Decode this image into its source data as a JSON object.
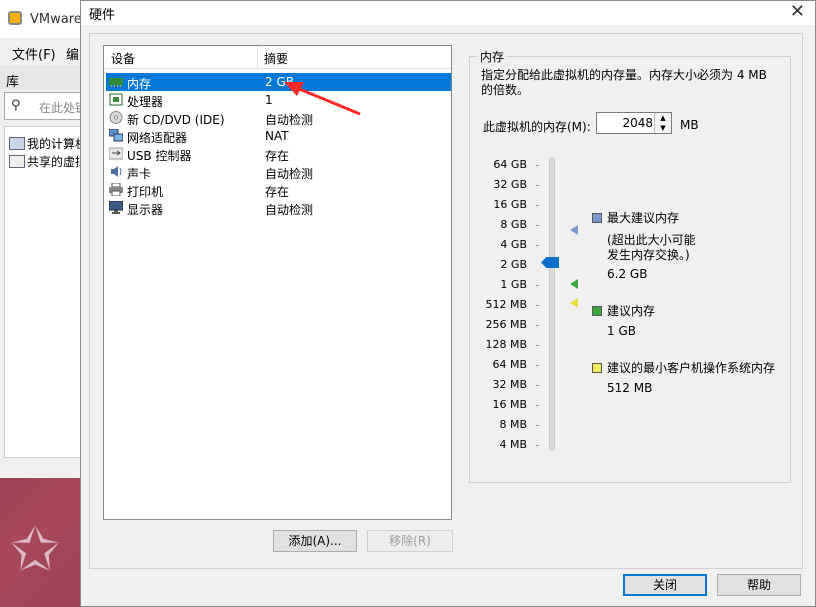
{
  "vmware": {
    "title": "VMware",
    "menu": [
      "文件(F)",
      "编"
    ],
    "library_label": "库",
    "search_placeholder": "在此处键入",
    "tree": [
      "我的计算机",
      "共享的虚拟机"
    ]
  },
  "dialog": {
    "title": "硬件",
    "list_headers": {
      "device": "设备",
      "summary": "摘要"
    },
    "devices": [
      {
        "name": "内存",
        "summary": "2 GB",
        "icon": "memory-icon",
        "selected": true
      },
      {
        "name": "处理器",
        "summary": "1",
        "icon": "processor-icon"
      },
      {
        "name": "新 CD/DVD (IDE)",
        "summary": "自动检测",
        "icon": "cd-icon"
      },
      {
        "name": "网络适配器",
        "summary": "NAT",
        "icon": "network-icon"
      },
      {
        "name": "USB 控制器",
        "summary": "存在",
        "icon": "usb-icon"
      },
      {
        "name": "声卡",
        "summary": "自动检测",
        "icon": "sound-icon"
      },
      {
        "name": "打印机",
        "summary": "存在",
        "icon": "printer-icon"
      },
      {
        "name": "显示器",
        "summary": "自动检测",
        "icon": "display-icon"
      }
    ],
    "add_button": "添加(A)...",
    "remove_button": "移除(R)",
    "close_button": "关闭",
    "help_button": "帮助"
  },
  "memory": {
    "group_title": "内存",
    "description": "指定分配给此虚拟机的内存量。内存大小必须为 4 MB 的倍数。",
    "field_label": "此虚拟机的内存(M):",
    "value": "2048",
    "unit": "MB",
    "scale": [
      "64 GB",
      "32 GB",
      "16 GB",
      "8 GB",
      "4 GB",
      "2 GB",
      "1 GB",
      "512 MB",
      "256 MB",
      "128 MB",
      "64 MB",
      "32 MB",
      "16 MB",
      "8 MB",
      "4 MB"
    ],
    "current_level": "2 GB",
    "legend": [
      {
        "label": "最大建议内存",
        "note1": "(超出此大小可能",
        "note2": "发生内存交换。)",
        "value": "6.2 GB",
        "color": "#7c9ad0"
      },
      {
        "label": "建议内存",
        "value": "1 GB",
        "color": "#3aa53a"
      },
      {
        "label": "建议的最小客户机操作系统内存",
        "value": "512 MB",
        "color": "#f0e860"
      }
    ]
  }
}
